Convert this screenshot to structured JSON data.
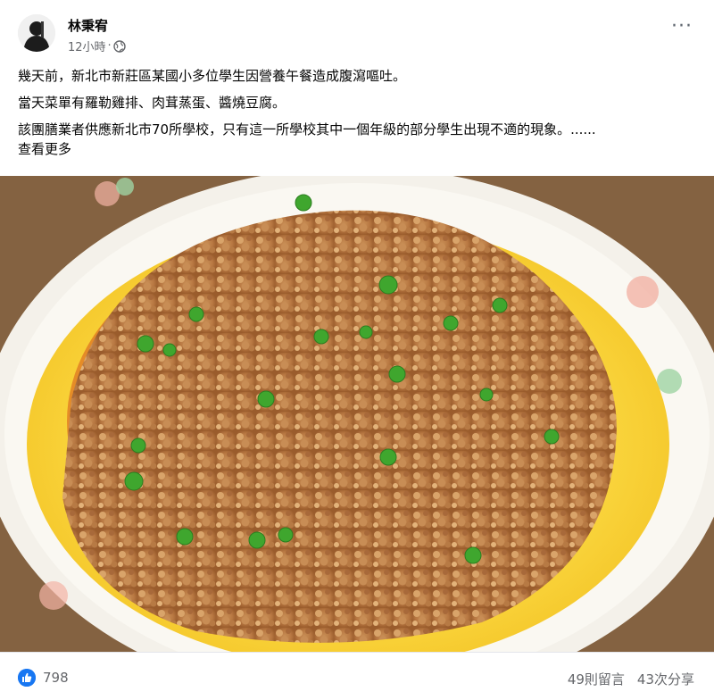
{
  "post": {
    "author": "林秉宥",
    "time": "12小時",
    "dot": "·",
    "more_label": "···",
    "paragraphs": [
      "幾天前，新北市新莊區某國小多位學生因營養午餐造成腹瀉嘔吐。",
      "當天菜單有羅勒雞排、肉茸蒸蛋、醬燒豆腐。",
      "該團膳業者供應新北市70所學校，只有這一所學校其中一個年級的部分學生出現不適的現象。......"
    ],
    "see_more": "查看更多"
  },
  "footer": {
    "likes": "798",
    "comments": "49則留言",
    "shares": "43次分享"
  },
  "colors": {
    "accent": "#1877f2",
    "muted": "#65676b"
  },
  "icons": [
    "globe-icon",
    "more-icon",
    "like-icon"
  ]
}
